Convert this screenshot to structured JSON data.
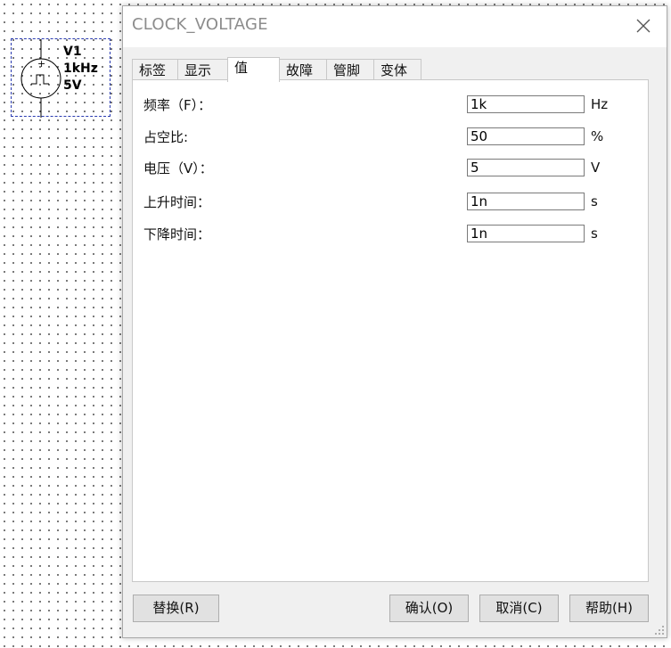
{
  "schematic": {
    "component_name": "V1",
    "frequency_label": "1kHz",
    "voltage_label": "5V",
    "plus_sign": "+"
  },
  "dialog": {
    "title": "CLOCK_VOLTAGE",
    "close_icon": "close-icon",
    "tabs": [
      {
        "label": "标签",
        "active": false
      },
      {
        "label": "显示",
        "active": false
      },
      {
        "label": "值",
        "active": true
      },
      {
        "label": "故障",
        "active": false
      },
      {
        "label": "管脚",
        "active": false
      },
      {
        "label": "变体",
        "active": false
      }
    ],
    "fields": [
      {
        "label": "频率（F）：",
        "value": "1k",
        "unit": "Hz"
      },
      {
        "label": "占空比:",
        "value": "50",
        "unit": "%"
      },
      {
        "label": "电压（V）：",
        "value": "5",
        "unit": "V"
      },
      {
        "label": "上升时间：",
        "value": "1n",
        "unit": "s"
      },
      {
        "label": "下降时间：",
        "value": "1n",
        "unit": "s"
      }
    ],
    "buttons": {
      "replace": "替换(R)",
      "ok": "确认(O)",
      "cancel": "取消(C)",
      "help": "帮助(H)"
    }
  }
}
